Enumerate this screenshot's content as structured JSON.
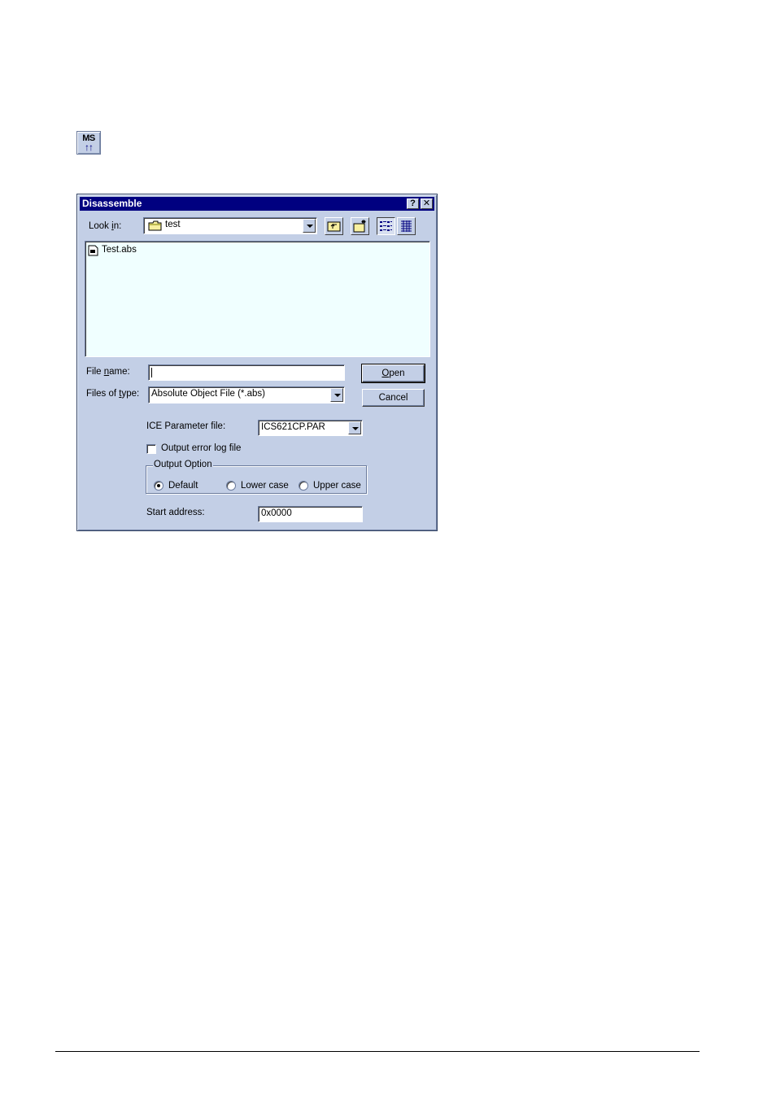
{
  "toolbar_icon": {
    "line1": "MS",
    "line2": "↑↑"
  },
  "dialog": {
    "title": "Disassemble",
    "help_glyph": "?",
    "close_glyph": "✕",
    "look_in": {
      "label_pre": "Look ",
      "label_ul": "i",
      "label_post": "n:",
      "value": "test"
    },
    "tools": [
      "up-one-level-icon",
      "create-new-folder-icon",
      "list-view-icon",
      "details-view-icon"
    ],
    "files": [
      {
        "name": "Test.abs",
        "icon": "file-icon"
      }
    ],
    "file_name": {
      "label_pre": "File ",
      "label_ul": "n",
      "label_post": "ame:",
      "value": ""
    },
    "files_of_type": {
      "label_pre": "Files of ",
      "label_ul": "t",
      "label_post": "ype:",
      "value": "Absolute Object File (*.abs)"
    },
    "open_button": {
      "ul": "O",
      "rest": "pen"
    },
    "cancel_button": "Cancel",
    "ice_param": {
      "label": "ICE Parameter file:",
      "value": "ICS621CP.PAR"
    },
    "output_error_log": {
      "label": "Output error log file",
      "checked": false
    },
    "output_option": {
      "legend": "Output Option",
      "options": [
        {
          "label": "Default",
          "selected": true
        },
        {
          "label": "Lower case",
          "selected": false
        },
        {
          "label": "Upper case",
          "selected": false
        }
      ]
    },
    "start_address": {
      "label": "Start address:",
      "value": "0x0000"
    }
  }
}
